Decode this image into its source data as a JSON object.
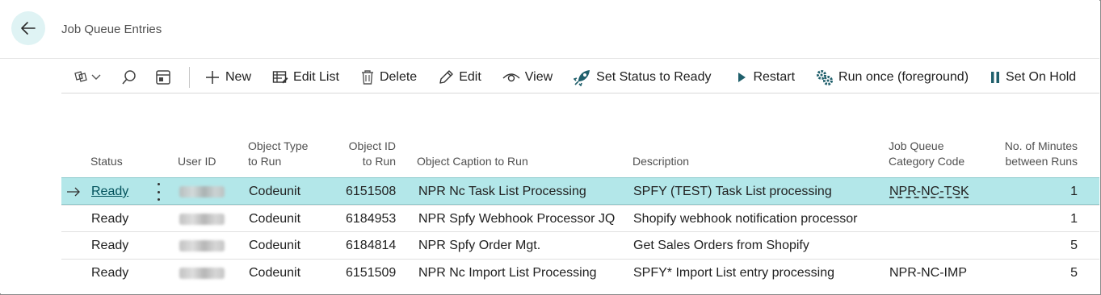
{
  "header": {
    "title": "Job Queue Entries"
  },
  "toolbar": {
    "new_label": "New",
    "edit_list_label": "Edit List",
    "delete_label": "Delete",
    "edit_label": "Edit",
    "view_label": "View",
    "set_status_label": "Set Status to Ready",
    "restart_label": "Restart",
    "run_once_label": "Run once (foreground)",
    "set_on_hold_label": "Set On Hold"
  },
  "table": {
    "columns": {
      "status": "Status",
      "user_id": "User ID",
      "object_type_1": "Object Type",
      "object_type_2": "to Run",
      "object_id_1": "Object ID",
      "object_id_2": "to Run",
      "caption": "Object Caption to Run",
      "description": "Description",
      "category_1": "Job Queue",
      "category_2": "Category Code",
      "minutes_1": "No. of Minutes",
      "minutes_2": "between Runs"
    },
    "rows": [
      {
        "status": "Ready",
        "object_type": "Codeunit",
        "object_id": "6151508",
        "caption": "NPR Nc Task List Processing",
        "description": "SPFY (TEST) Task List processing",
        "category": "NPR-NC-TSK",
        "minutes": "1"
      },
      {
        "status": "Ready",
        "object_type": "Codeunit",
        "object_id": "6184953",
        "caption": "NPR Spfy Webhook Processor JQ",
        "description": "Shopify webhook notification processor",
        "category": "",
        "minutes": "1"
      },
      {
        "status": "Ready",
        "object_type": "Codeunit",
        "object_id": "6184814",
        "caption": "NPR Spfy Order Mgt.",
        "description": "Get Sales Orders from Shopify",
        "category": "",
        "minutes": "5"
      },
      {
        "status": "Ready",
        "object_type": "Codeunit",
        "object_id": "6151509",
        "caption": "NPR Nc Import List Processing",
        "description": "SPFY* Import List entry processing",
        "category": "NPR-NC-IMP",
        "minutes": "5"
      }
    ]
  },
  "colors": {
    "accent": "#00505a",
    "selected_row": "#b3e7e9",
    "back_button_bg": "#dff3f4"
  },
  "icons": [
    "back-arrow-icon",
    "filter-icon",
    "chevron-down-icon",
    "search-icon",
    "layout-icon",
    "plus-icon",
    "edit-list-icon",
    "trash-icon",
    "pencil-icon",
    "eye-icon",
    "rocket-icon",
    "play-icon",
    "gears-icon",
    "pause-icon",
    "row-arrow-icon"
  ]
}
